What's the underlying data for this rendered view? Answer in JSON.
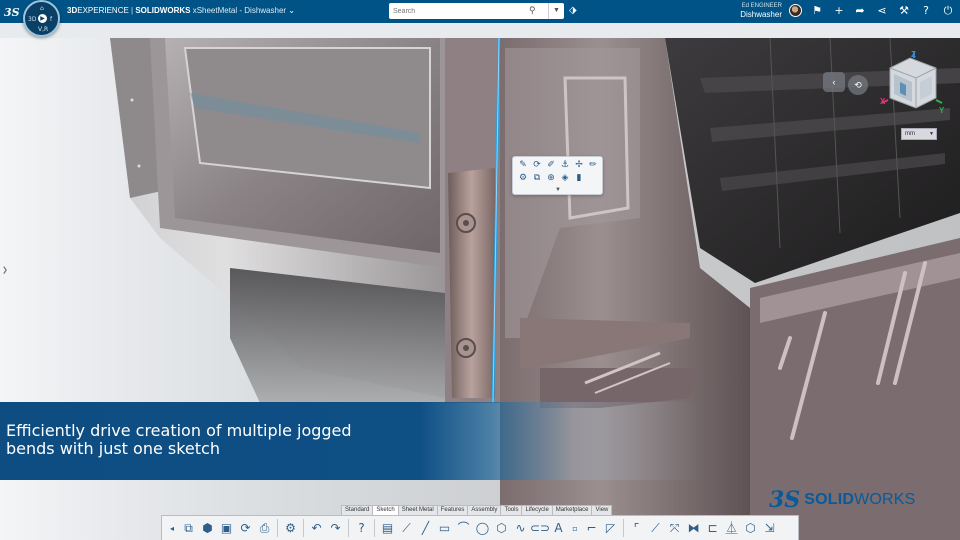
{
  "topbar": {
    "brand_3d": "3D",
    "brand_experience": "EXPERIENCE",
    "brand_separator": " | ",
    "brand_solidworks": "SOLIDWORKS",
    "document": "xSheetMetal - Dishwasher",
    "compass_quadrants": [
      "3D",
      "V,R",
      "f",
      "➤"
    ],
    "search_placeholder": "Search",
    "user_role": "Ed ENGINEER",
    "user_name": "Dishwasher",
    "icons": [
      "tag-icon",
      "avatar",
      "share-icon",
      "add-icon",
      "forward-icon",
      "network-icon",
      "tools-icon",
      "help-icon",
      "power-icon"
    ]
  },
  "context_toolbar": {
    "icons_row1": [
      "edit-feature-icon",
      "rebuild-icon",
      "sketch-icon",
      "anchor-icon",
      "move-icon",
      "edit-sketch-icon"
    ],
    "icons_row2": [
      "sheet-metal-icon",
      "jog-icon",
      "dimension-icon",
      "hide-icon",
      "appearance-icon"
    ]
  },
  "viewcube": {
    "axis_x": "X",
    "axis_y": "Y",
    "axis_z": "Z",
    "units": "mm"
  },
  "caption": {
    "line1": "Efficiently drive creation of multiple jogged",
    "line2": "bends with just one sketch"
  },
  "brand": {
    "mark": "3S",
    "solid": "SOLID",
    "works": "WORKS"
  },
  "command_tabs": [
    "Standard",
    "Sketch",
    "Sheet Metal",
    "Features",
    "Assembly",
    "Tools",
    "Lifecycle",
    "Marketplace",
    "View"
  ],
  "active_tab": "Sketch",
  "command_icons": [
    "collapse-icon",
    "save-group-icon",
    "3d-part-icon",
    "save-icon",
    "rebuild-icon",
    "print-icon",
    "settings-icon",
    "undo-icon",
    "redo-icon",
    "help-icon",
    "sketch-icon",
    "smart-dimension-icon",
    "line-icon",
    "rectangle-icon",
    "arc-icon",
    "circle-icon",
    "polygon-icon",
    "spline-icon",
    "slot-icon",
    "text-icon",
    "point-icon",
    "fillet-icon",
    "chamfer-icon",
    "offset-icon",
    "trim-icon",
    "convert-icon",
    "mirror-icon",
    "pattern-icon",
    "move-entities-icon",
    "3d-sketch-icon",
    "exit-sketch-icon"
  ]
}
